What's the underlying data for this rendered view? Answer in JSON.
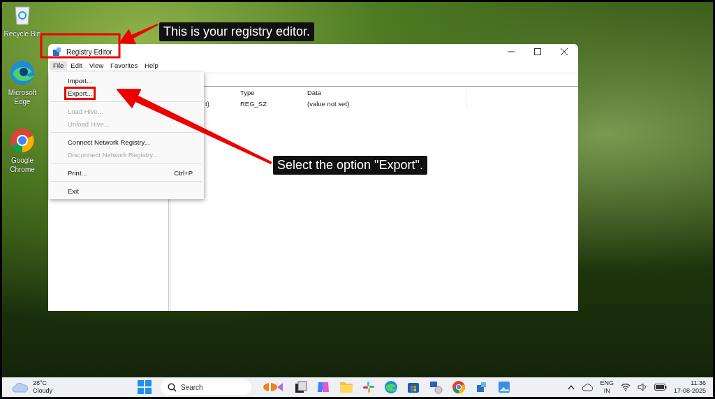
{
  "desktop_icons": [
    {
      "label": "Recycle Bin",
      "kind": "recycle"
    },
    {
      "label": "Microsoft Edge",
      "kind": "edge"
    },
    {
      "label": "Google Chrome",
      "kind": "chrome"
    }
  ],
  "window": {
    "title": "Registry Editor",
    "title_highlighted": true,
    "menu": [
      {
        "label": "File",
        "selected": true
      },
      {
        "label": "Edit",
        "selected": false
      },
      {
        "label": "View",
        "selected": false
      },
      {
        "label": "Favorites",
        "selected": false
      },
      {
        "label": "Help",
        "selected": false
      }
    ],
    "file_menu": [
      {
        "kind": "item",
        "label": "Import...",
        "disabled": false,
        "highlighted": false
      },
      {
        "kind": "item",
        "label": "Export...",
        "disabled": false,
        "highlighted": true
      },
      {
        "kind": "separator"
      },
      {
        "kind": "item",
        "label": "Load Hive...",
        "disabled": true,
        "highlighted": false
      },
      {
        "kind": "item",
        "label": "Unload Hive...",
        "disabled": true,
        "highlighted": false
      },
      {
        "kind": "separator"
      },
      {
        "kind": "item",
        "label": "Connect Network Registry...",
        "disabled": false,
        "highlighted": false
      },
      {
        "kind": "item",
        "label": "Disconnect Network Registry...",
        "disabled": true,
        "highlighted": false
      },
      {
        "kind": "separator"
      },
      {
        "kind": "item",
        "label": "Print...",
        "shortcut": "Ctrl+P",
        "disabled": false,
        "highlighted": false
      },
      {
        "kind": "separator"
      },
      {
        "kind": "item",
        "label": "Exit",
        "disabled": false,
        "highlighted": false
      }
    ],
    "table": {
      "columns": [
        "",
        "Type",
        "Data"
      ],
      "rows": [
        {
          "cells": [
            "t)",
            "REG_SZ",
            "(value not set)"
          ]
        }
      ]
    }
  },
  "annotations": [
    {
      "text": "This is your registry editor."
    },
    {
      "text": "Select the option \"Export\"."
    }
  ],
  "taskbar": {
    "weather": {
      "temperature": "28°C",
      "condition": "Cloudy"
    },
    "search": {
      "placeholder": "Search"
    },
    "language": [
      "ENG",
      "IN"
    ],
    "time": "11:36",
    "date": "17-08-2025"
  }
}
